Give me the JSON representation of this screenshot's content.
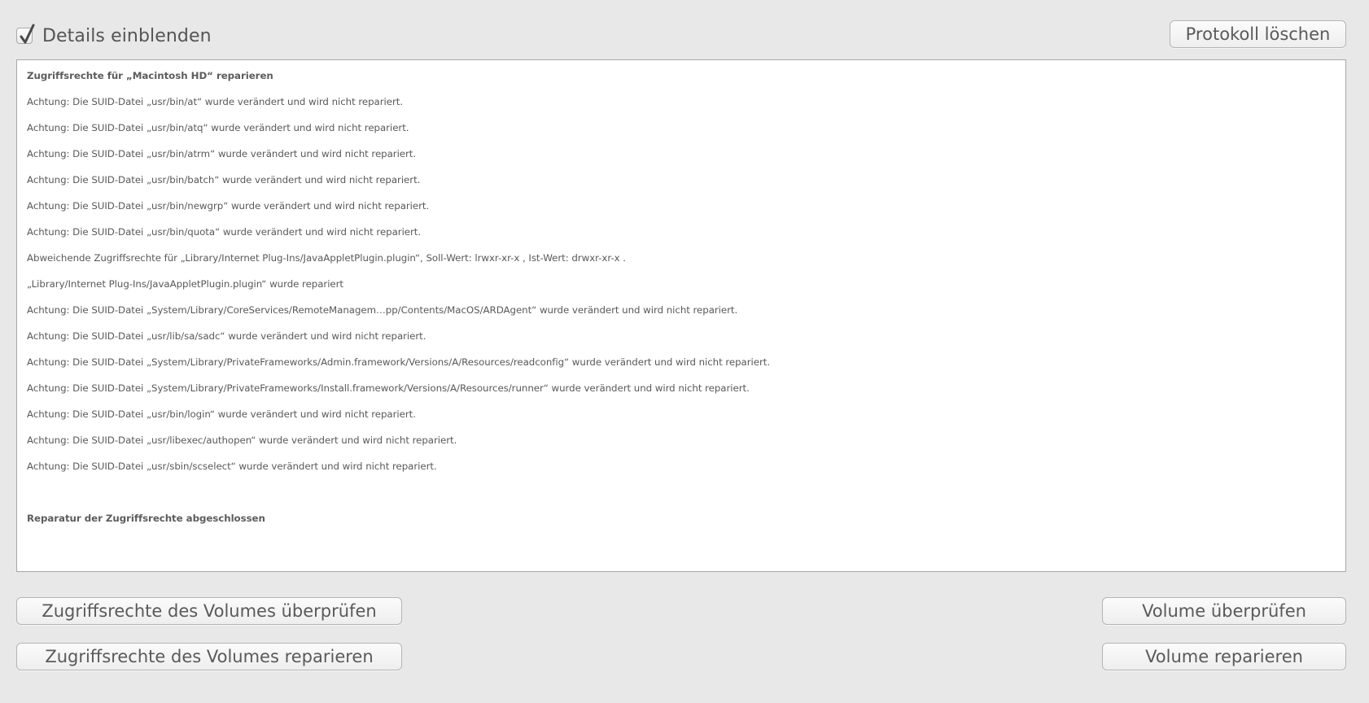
{
  "top": {
    "details_checkbox_checked": true,
    "details_label": "Details einblenden",
    "clear_log_label": "Protokoll löschen"
  },
  "log": {
    "lines": [
      {
        "text": "Zugriffsrechte für „Macintosh HD“ reparieren",
        "bold": true
      },
      {
        "text": "Achtung: Die SUID-Datei „usr/bin/at“ wurde verändert und wird nicht repariert.",
        "bold": false
      },
      {
        "text": "Achtung: Die SUID-Datei „usr/bin/atq“ wurde verändert und wird nicht repariert.",
        "bold": false
      },
      {
        "text": "Achtung: Die SUID-Datei „usr/bin/atrm“ wurde verändert und wird nicht repariert.",
        "bold": false
      },
      {
        "text": "Achtung: Die SUID-Datei „usr/bin/batch“ wurde verändert und wird nicht repariert.",
        "bold": false
      },
      {
        "text": "Achtung: Die SUID-Datei „usr/bin/newgrp“ wurde verändert und wird nicht repariert.",
        "bold": false
      },
      {
        "text": "Achtung: Die SUID-Datei „usr/bin/quota“ wurde verändert und wird nicht repariert.",
        "bold": false
      },
      {
        "text": "Abweichende Zugriffsrechte für „Library/Internet Plug-Ins/JavaAppletPlugin.plugin“, Soll-Wert: lrwxr-xr-x , Ist-Wert: drwxr-xr-x .",
        "bold": false
      },
      {
        "text": "„Library/Internet Plug-Ins/JavaAppletPlugin.plugin“ wurde repariert",
        "bold": false
      },
      {
        "text": "Achtung: Die SUID-Datei „System/Library/CoreServices/RemoteManagem…pp/Contents/MacOS/ARDAgent“ wurde verändert und wird nicht repariert.",
        "bold": false
      },
      {
        "text": "Achtung: Die SUID-Datei „usr/lib/sa/sadc“ wurde verändert und wird nicht repariert.",
        "bold": false
      },
      {
        "text": "Achtung: Die SUID-Datei „System/Library/PrivateFrameworks/Admin.framework/Versions/A/Resources/readconfig“ wurde verändert und wird nicht repariert.",
        "bold": false
      },
      {
        "text": "Achtung: Die SUID-Datei „System/Library/PrivateFrameworks/Install.framework/Versions/A/Resources/runner“ wurde verändert und wird nicht repariert.",
        "bold": false
      },
      {
        "text": "Achtung: Die SUID-Datei „usr/bin/login“ wurde verändert und wird nicht repariert.",
        "bold": false
      },
      {
        "text": "Achtung: Die SUID-Datei „usr/libexec/authopen“ wurde verändert und wird nicht repariert.",
        "bold": false
      },
      {
        "text": "Achtung: Die SUID-Datei „usr/sbin/scselect“ wurde verändert und wird nicht repariert.",
        "bold": false
      },
      {
        "text": "",
        "bold": false
      },
      {
        "text": "Reparatur der Zugriffsrechte abgeschlossen",
        "bold": true
      }
    ]
  },
  "buttons": {
    "verify_permissions": "Zugriffsrechte des Volumes überprüfen",
    "repair_permissions": "Zugriffsrechte des Volumes reparieren",
    "verify_volume": "Volume überprüfen",
    "repair_volume": "Volume reparieren"
  },
  "icons": {
    "checkmark": "checkmark-icon"
  }
}
